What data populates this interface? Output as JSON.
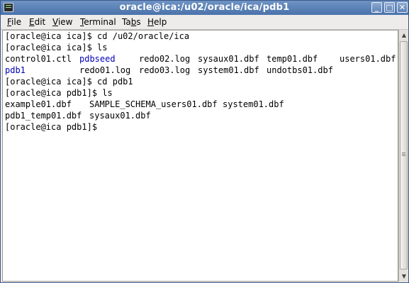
{
  "window": {
    "title": "oracle@ica:/u02/oracle/ica/pdb1",
    "buttons": {
      "minimize": "_",
      "maximize": "□",
      "close": "✕"
    }
  },
  "menubar": {
    "file": {
      "u": "F",
      "rest": "ile"
    },
    "edit": {
      "u": "E",
      "rest": "dit"
    },
    "view": {
      "u": "V",
      "rest": "iew"
    },
    "terminal": {
      "u": "T",
      "rest": "erminal"
    },
    "tabs": {
      "pre": "Ta",
      "u": "b",
      "rest": "s"
    },
    "help": {
      "u": "H",
      "rest": "elp"
    }
  },
  "terminal": {
    "line1": "[oracle@ica ica]$ cd /u02/oracle/ica",
    "line2": "[oracle@ica ica]$ ls",
    "line3": {
      "f1": "control01.ctl",
      "f2": "pdbseed",
      "f3": "redo02.log",
      "f4": "sysaux01.dbf",
      "f5": "temp01.dbf",
      "f6": "users01.dbf"
    },
    "line4": {
      "f1": "pdb1",
      "f2": "redo01.log",
      "f3": "redo03.log",
      "f4": "system01.dbf",
      "f5": "undotbs01.dbf"
    },
    "line5": "[oracle@ica ica]$ cd pdb1",
    "line6": "[oracle@ica pdb1]$ ls",
    "line7": {
      "f1": "example01.dbf",
      "f2": "SAMPLE_SCHEMA_users01.dbf",
      "f3": "system01.dbf"
    },
    "line8": {
      "f1": "pdb1_temp01.dbf",
      "f2": "sysaux01.dbf"
    },
    "line9": "[oracle@ica pdb1]$ ",
    "directory_color": "#0000b8"
  },
  "scrollbar": {
    "up_arrow": "▲",
    "down_arrow": "▼"
  }
}
